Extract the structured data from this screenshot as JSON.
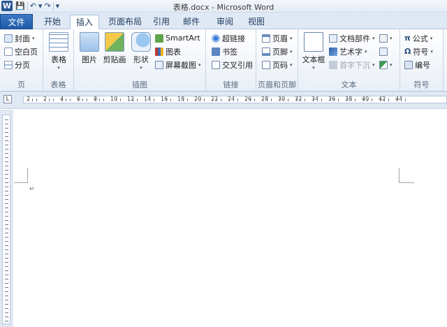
{
  "window": {
    "title": "表格.docx - Microsoft Word",
    "app_icon": "W",
    "qat": {
      "save": "💾",
      "undo": "↶",
      "undo_drop": "▾",
      "redo": "↷",
      "customize": "▾"
    }
  },
  "tabs": {
    "file": "文件",
    "items": [
      {
        "label": "开始"
      },
      {
        "label": "插入",
        "active": true
      },
      {
        "label": "页面布局"
      },
      {
        "label": "引用"
      },
      {
        "label": "邮件"
      },
      {
        "label": "审阅"
      },
      {
        "label": "视图"
      }
    ]
  },
  "ribbon": {
    "groups": {
      "pages": "页",
      "table": "表格",
      "illustrations": "插图",
      "links": "链接",
      "header_footer": "页眉和页脚",
      "text": "文本",
      "symbols": "符号"
    },
    "pages": {
      "cover": "封面",
      "blank": "空白页",
      "break": "分页"
    },
    "table": {
      "table": "表格"
    },
    "illustrations": {
      "picture": "图片",
      "clipart": "剪贴画",
      "shapes": "形状",
      "smartart": "SmartArt",
      "chart": "图表",
      "screenshot": "屏幕截图"
    },
    "links": {
      "hyperlink": "超链接",
      "bookmark": "书签",
      "crossref": "交叉引用"
    },
    "header_footer": {
      "header": "页眉",
      "footer": "页脚",
      "pagenum": "页码"
    },
    "text": {
      "textbox": "文本框",
      "quickparts": "文档部件",
      "wordart": "艺术字",
      "dropcap": "首字下沉"
    },
    "symbols": {
      "equation": "公式",
      "symbol": "符号",
      "number": "编号"
    }
  },
  "ruler": {
    "marks": [
      "2",
      "2",
      "4",
      "6",
      "8",
      "10",
      "12",
      "14",
      "16",
      "18",
      "20",
      "22",
      "24",
      "26",
      "28",
      "30",
      "32",
      "34",
      "36",
      "38",
      "40",
      "42",
      "44"
    ],
    "corner": "L"
  },
  "document": {
    "para_mark": "↵"
  },
  "colors": {
    "file_tab": "#2b5797",
    "accent": "#1f5aa6"
  }
}
